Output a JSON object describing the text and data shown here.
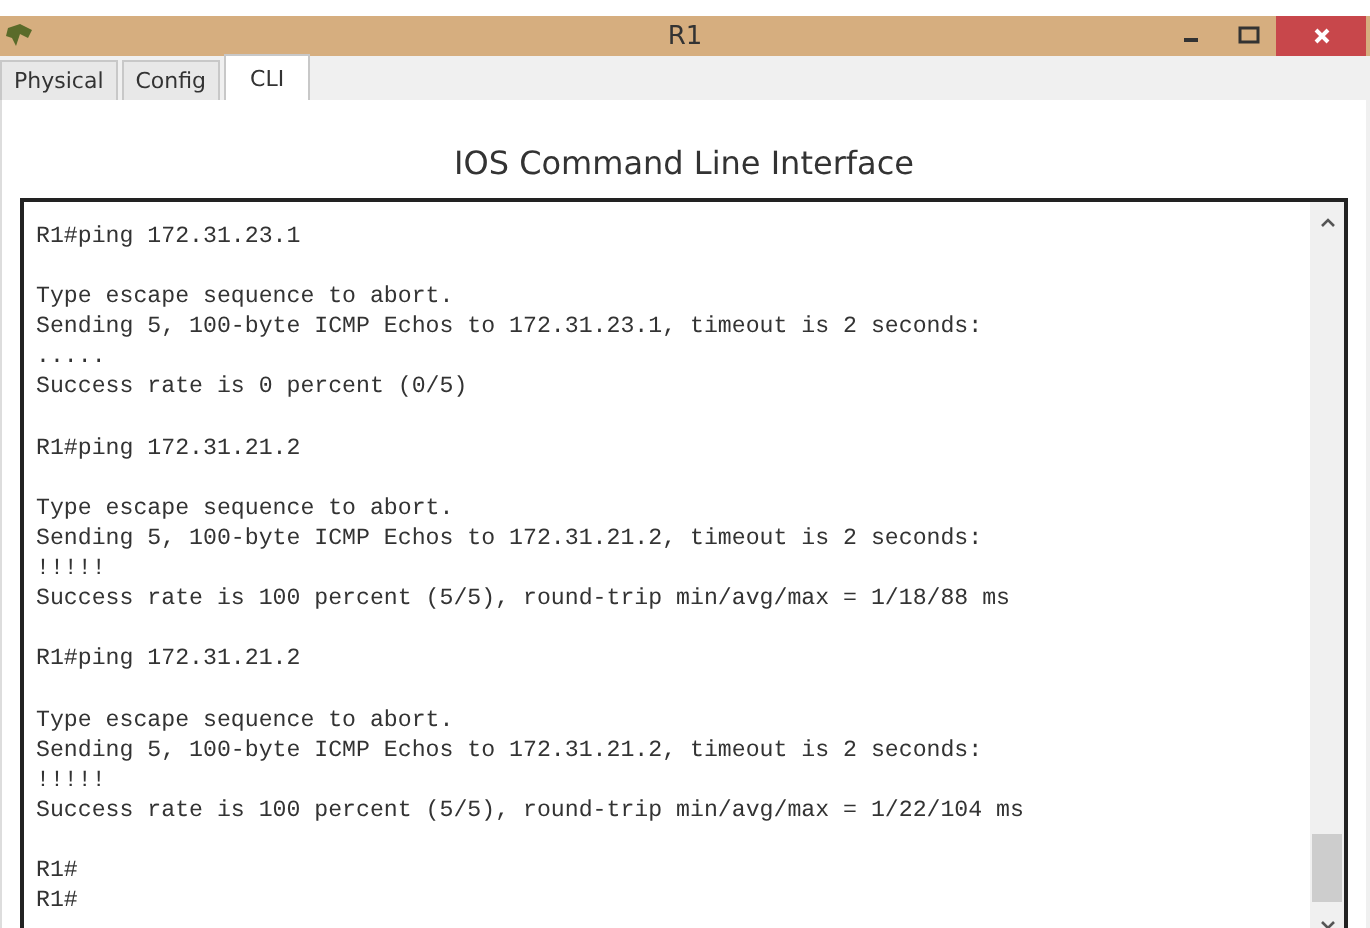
{
  "window": {
    "title": "R1"
  },
  "tabs": [
    {
      "label": "Physical",
      "selected": false
    },
    {
      "label": "Config",
      "selected": false
    },
    {
      "label": "CLI",
      "selected": true
    }
  ],
  "heading": "IOS Command Line Interface",
  "terminal": {
    "blocks": [
      [
        "R1#ping 172.31.23.1"
      ],
      [
        "Type escape sequence to abort.",
        "Sending 5, 100-byte ICMP Echos to 172.31.23.1, timeout is 2 seconds:",
        ".....",
        "Success rate is 0 percent (0/5)"
      ],
      [
        "R1#ping 172.31.21.2"
      ],
      [
        "Type escape sequence to abort.",
        "Sending 5, 100-byte ICMP Echos to 172.31.21.2, timeout is 2 seconds:",
        "!!!!!",
        "Success rate is 100 percent (5/5), round-trip min/avg/max = 1/18/88 ms"
      ],
      [
        "R1#ping 172.31.21.2"
      ],
      [
        "Type escape sequence to abort.",
        "Sending 5, 100-byte ICMP Echos to 172.31.21.2, timeout is 2 seconds:",
        "!!!!!",
        "Success rate is 100 percent (5/5), round-trip min/avg/max = 1/22/104 ms"
      ],
      [
        "R1#",
        "R1#"
      ]
    ]
  }
}
